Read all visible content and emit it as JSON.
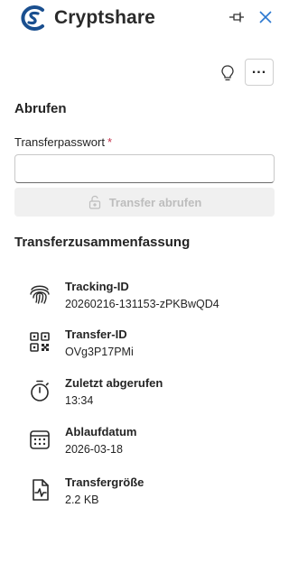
{
  "app": {
    "brand": "Cryptshare",
    "accent": "#1a4f8f",
    "close_color": "#2b78d0"
  },
  "toolbar": {
    "icons": [
      "pin-icon",
      "close-icon",
      "lightbulb-icon",
      "more-options-icon"
    ],
    "more_label": "..."
  },
  "retrieve": {
    "heading": "Abrufen",
    "password_label": "Transferpasswort",
    "required_mark": "*",
    "password_value": "",
    "button_label": "Transfer abrufen",
    "button_icon": "unlock-icon"
  },
  "summary": {
    "heading": "Transferzusammenfassung",
    "items": [
      {
        "icon": "fingerprint-icon",
        "title": "Tracking-ID",
        "value": "20260216-131153-zPKBwQD4"
      },
      {
        "icon": "qr-code-icon",
        "title": "Transfer-ID",
        "value": "OVg3P17PMi"
      },
      {
        "icon": "timer-icon",
        "title": "Zuletzt abgerufen",
        "value": "13:34"
      },
      {
        "icon": "calendar-icon",
        "title": "Ablaufdatum",
        "value": "2026-03-18"
      },
      {
        "icon": "file-size-icon",
        "title": "Transfergröße",
        "value": "2.2 KB"
      }
    ]
  }
}
